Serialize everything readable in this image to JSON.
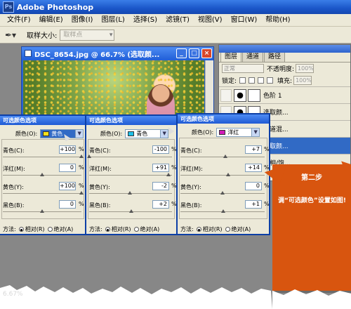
{
  "app": {
    "title": "Adobe Photoshop",
    "logo_text": "Ps",
    "menu": [
      "文件(F)",
      "编辑(E)",
      "图像(I)",
      "图层(L)",
      "选择(S)",
      "滤镜(T)",
      "视图(V)",
      "窗口(W)",
      "帮助(H)"
    ]
  },
  "options_bar": {
    "tool_icon": "eyedropper-icon",
    "sample_label": "取样大小:",
    "sample_value": "取样点"
  },
  "document": {
    "title": "DSC_8654.jpg @ 66.7% (选取颜...",
    "status_zoom": "6.67%"
  },
  "layers_panel": {
    "tabs": [
      "图层",
      "通道",
      "路径"
    ],
    "blend_mode": "正常",
    "opacity_label": "不透明度:",
    "opacity_value": "100%",
    "lock_label": "锁定:",
    "fill_label": "填充:",
    "fill_value": "100%",
    "layers": [
      {
        "name": "色阶 1",
        "thumb": "adjustment",
        "selected": false
      },
      {
        "name": "选取颜...",
        "thumb": "adjustment",
        "selected": false
      },
      {
        "name": "通道混...",
        "thumb": "adjustment",
        "selected": false
      },
      {
        "name": "选取颜...",
        "thumb": "adjustment",
        "selected": true
      },
      {
        "name": "色相/饱...",
        "thumb": "adjustment",
        "selected": false
      }
    ]
  },
  "dialogs": [
    {
      "title": "可选颜色选项",
      "color_label": "颜色(O):",
      "color_name": "黄色",
      "swatch": "#f5e01a",
      "sliders": [
        {
          "label": "青色(C):",
          "value": "+100",
          "level": 100
        },
        {
          "label": "洋红(M):",
          "value": "0",
          "level": 0
        },
        {
          "label": "黄色(Y):",
          "value": "+100",
          "level": 100
        },
        {
          "label": "黑色(B):",
          "value": "0",
          "level": 0
        }
      ],
      "method_label": "方法:",
      "relative_label": "相对(R)",
      "absolute_label": "绝对(A)"
    },
    {
      "title": "可选颜色选项",
      "color_label": "颜色(O):",
      "color_name": "青色",
      "swatch": "#1ec0e8",
      "sliders": [
        {
          "label": "青色(C):",
          "value": "-100",
          "level": -100
        },
        {
          "label": "洋红(M):",
          "value": "+91",
          "level": 91
        },
        {
          "label": "黄色(Y):",
          "value": "-2",
          "level": -2
        },
        {
          "label": "黑色(B):",
          "value": "+2",
          "level": 2
        }
      ],
      "method_label": "方法:",
      "relative_label": "相对(R)",
      "absolute_label": "绝对(A)"
    },
    {
      "title": "可选颜色选项",
      "color_label": "颜色(O):",
      "color_name": "洋红",
      "swatch": "#d21bb8",
      "sliders": [
        {
          "label": "青色(C):",
          "value": "+7",
          "level": 7
        },
        {
          "label": "洋红(M):",
          "value": "+14",
          "level": 14
        },
        {
          "label": "黄色(Y):",
          "value": "0",
          "level": 0
        },
        {
          "label": "黑色(B):",
          "value": "+1",
          "level": 1
        }
      ],
      "method_label": "方法:",
      "relative_label": "相对(R)",
      "absolute_label": "绝对(A)"
    }
  ],
  "callout": {
    "title": "第二步",
    "body": "调“可选颜色”设置如图!"
  },
  "colors": {
    "xp_blue": "#2260d8",
    "dialog_bg": "#ece9d8",
    "callout": "#d8550f",
    "selection": "#316ac5"
  }
}
